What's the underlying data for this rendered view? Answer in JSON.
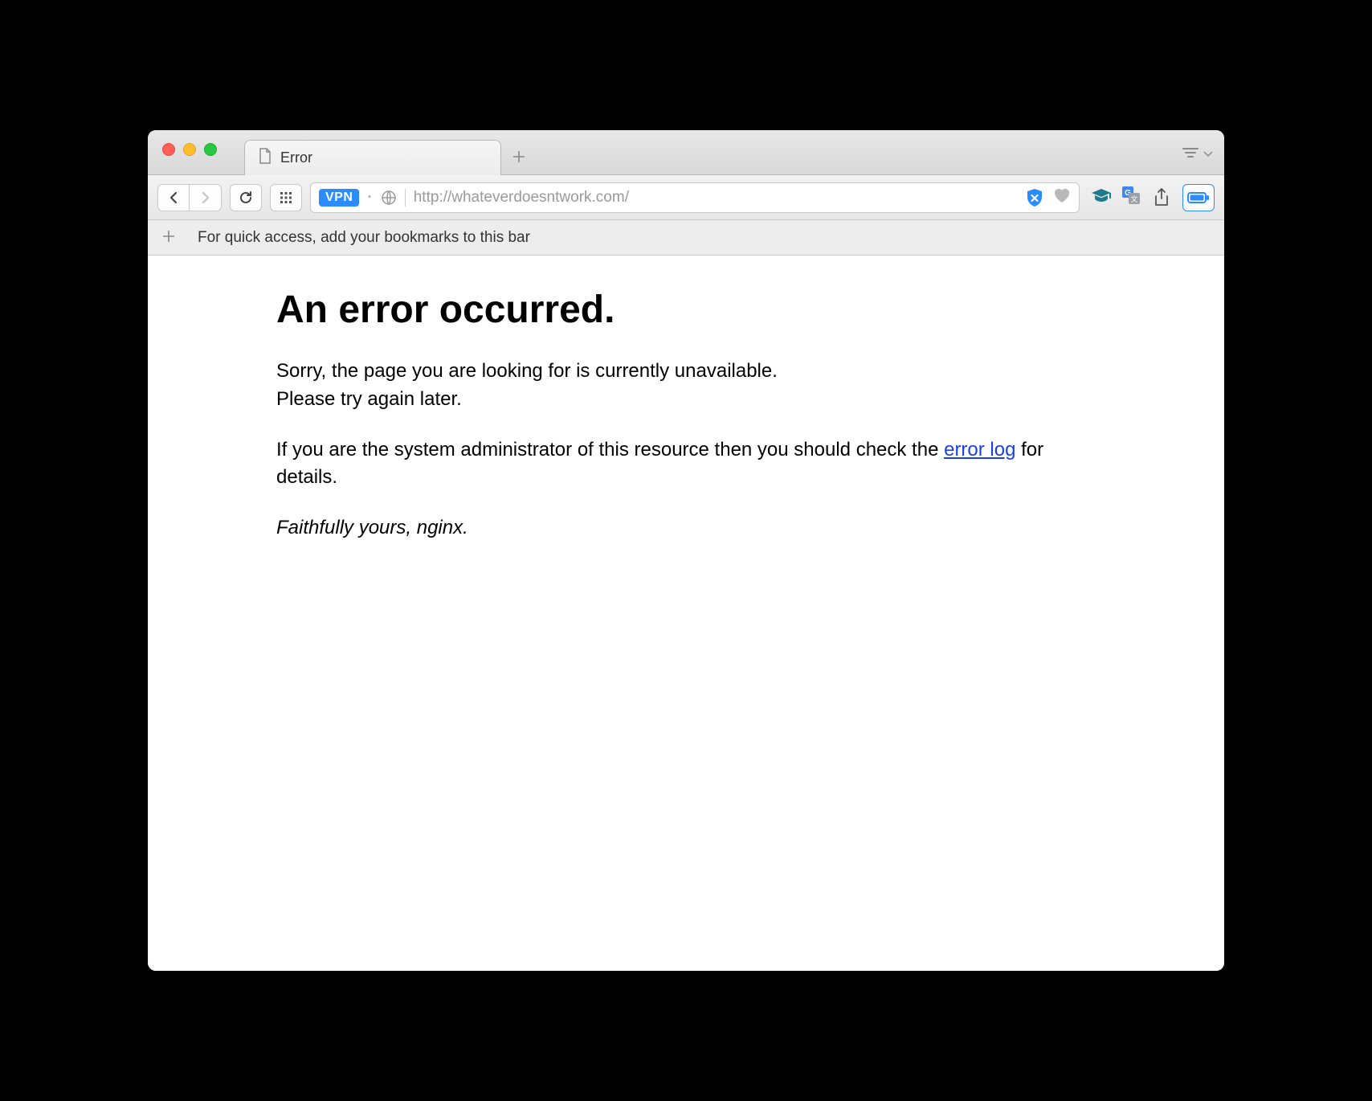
{
  "window": {
    "tab_title": "Error"
  },
  "toolbar": {
    "vpn_badge": "VPN",
    "url": "http://whateverdoesntwork.com/"
  },
  "bookmarks_bar": {
    "hint": "For quick access, add your bookmarks to this bar"
  },
  "page": {
    "heading": "An error occurred.",
    "paragraph1_line1": "Sorry, the page you are looking for is currently unavailable.",
    "paragraph1_line2": "Please try again later.",
    "paragraph2_before": "If you are the system administrator of this resource then you should check the ",
    "paragraph2_link": "error log",
    "paragraph2_after": " for details.",
    "signoff": "Faithfully yours, nginx."
  }
}
